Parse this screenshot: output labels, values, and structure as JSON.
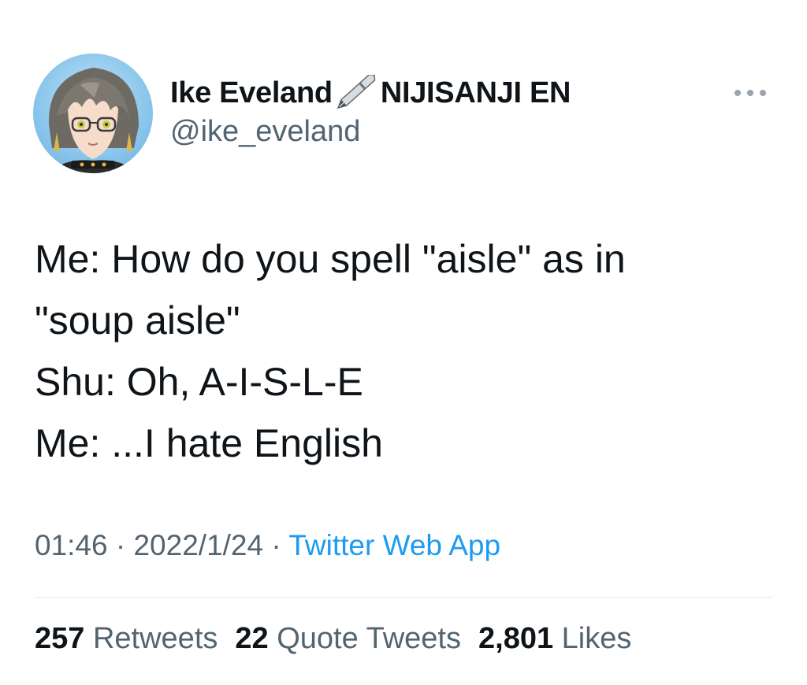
{
  "author": {
    "display_name": "Ike Eveland",
    "name_suffix": "NIJISANJI EN",
    "name_icon": "fountain-pen-icon",
    "handle": "@ike_eveland"
  },
  "tweet": {
    "lines": [
      "Me: How do you spell \"aisle\" as in",
      "\"soup aisle\"",
      "Shu: Oh, A-I-S-L-E",
      "Me: ...I hate English"
    ]
  },
  "meta": {
    "time": "01:46",
    "separator": "·",
    "date": "2022/1/24",
    "source": "Twitter Web App"
  },
  "stats": {
    "retweets_count": "257",
    "retweets_label": "Retweets",
    "quotes_count": "22",
    "quotes_label": "Quote Tweets",
    "likes_count": "2,801",
    "likes_label": "Likes"
  },
  "colors": {
    "text": "#0f1419",
    "secondary": "#536471",
    "link": "#1d9bf0",
    "divider": "#e4e8eb"
  }
}
